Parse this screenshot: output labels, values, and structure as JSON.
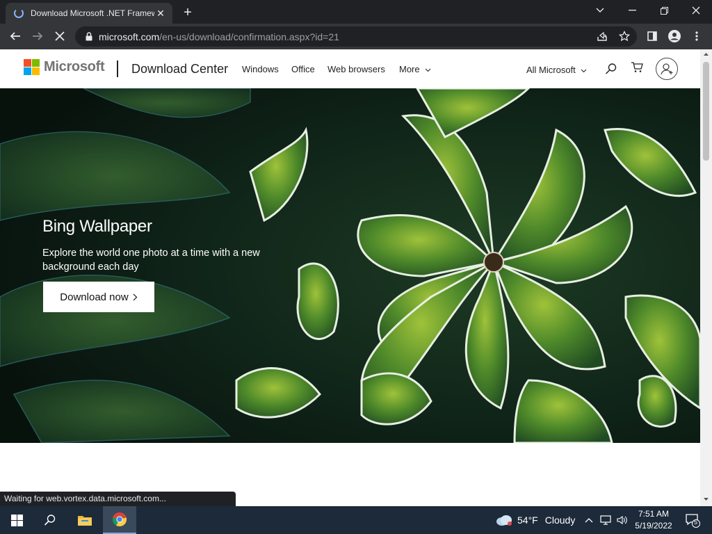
{
  "browser": {
    "tab_title": "Download Microsoft .NET Framew",
    "url_host": "microsoft.com",
    "url_path": "/en-us/download/confirmation.aspx?id=21",
    "status_text": "Waiting for web.vortex.data.microsoft.com..."
  },
  "header": {
    "logo_text": "Microsoft",
    "site_title": "Download Center",
    "nav": [
      "Windows",
      "Office",
      "Web browsers",
      "More"
    ],
    "all_microsoft": "All Microsoft"
  },
  "hero": {
    "title": "Bing Wallpaper",
    "description": "Explore the world one photo at a time with a new background each day",
    "button": "Download now"
  },
  "taskbar": {
    "weather_temp": "54°F",
    "weather_desc": "Cloudy",
    "time": "7:51 AM",
    "date": "5/19/2022",
    "notification_count": "5"
  },
  "colors": {
    "ms_red": "#f25022",
    "ms_green": "#7fba00",
    "ms_blue": "#00a4ef",
    "ms_yellow": "#ffb900"
  }
}
